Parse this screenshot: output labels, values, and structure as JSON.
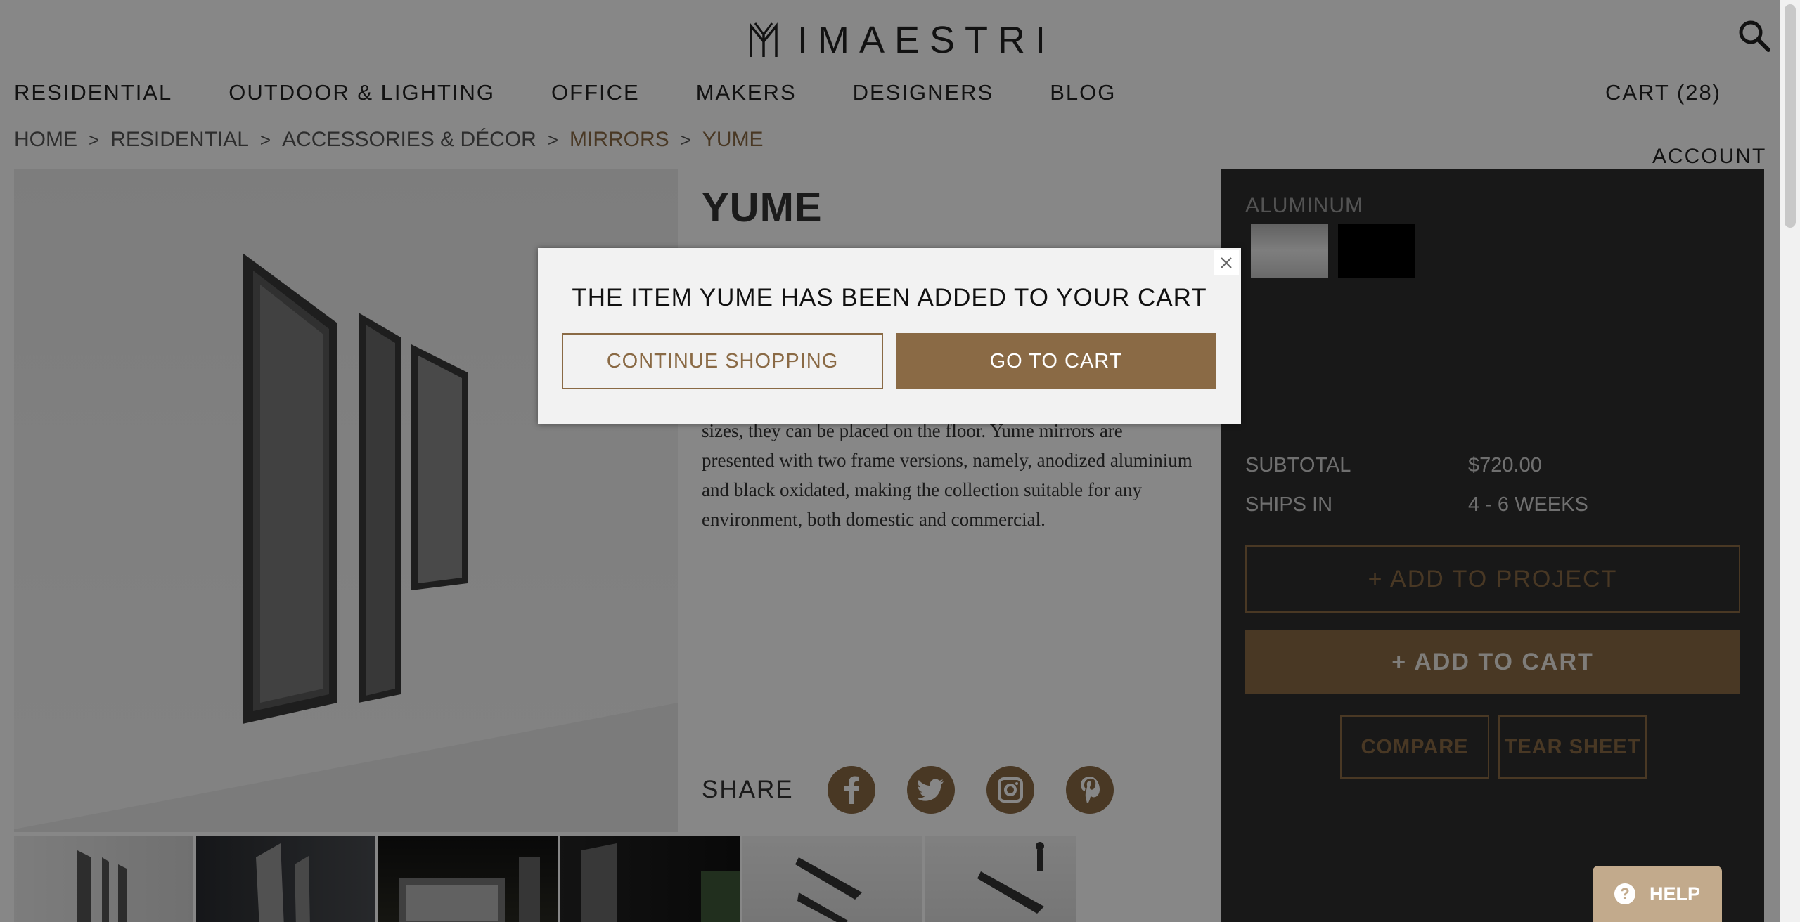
{
  "brand": {
    "name": "IMAESTRI"
  },
  "nav": {
    "items": [
      "RESIDENTIAL",
      "OUTDOOR & LIGHTING",
      "OFFICE",
      "MAKERS",
      "DESIGNERS",
      "BLOG"
    ],
    "cart_label": "CART (28)",
    "account_label": "ACCOUNT"
  },
  "breadcrumb": {
    "items": [
      "HOME",
      "RESIDENTIAL",
      "ACCESSORIES & DÉCOR",
      "MIRRORS",
      "YUME"
    ],
    "separator": ">"
  },
  "product": {
    "title": "YUME",
    "description_lines": [
      "sizes, they can be placed on the floor. Yume mirrors are",
      "presented with two frame versions, namely, anodized aluminium",
      "and black oxidated, making the collection suitable for any",
      "environment, both domestic and commercial."
    ],
    "share_label": "SHARE",
    "social_icons": [
      "facebook-icon",
      "twitter-icon",
      "instagram-icon",
      "pinterest-icon"
    ]
  },
  "options": {
    "finish_label": "ALUMINUM",
    "swatches": [
      {
        "name": "Aluminum",
        "color": "#d9d9d9"
      },
      {
        "name": "Black",
        "color": "#000000"
      }
    ]
  },
  "pricing": {
    "subtotal_label": "SUBTOTAL",
    "subtotal_value": "$720.00",
    "ships_label": "SHIPS IN",
    "ships_value": "4 - 6 WEEKS"
  },
  "actions": {
    "add_to_project": "+ ADD TO PROJECT",
    "add_to_cart": "+ ADD TO CART",
    "compare": "COMPARE",
    "tear_sheet": "TEAR SHEET",
    "help": "HELP"
  },
  "modal": {
    "message": "THE ITEM YUME HAS BEEN ADDED TO YOUR CART",
    "continue_label": "CONTINUE SHOPPING",
    "go_to_cart_label": "GO TO CART",
    "close_symbol": "✕"
  },
  "colors": {
    "accent": "#8a6a45",
    "panel": "#2e2e2e",
    "help": "#c2aa8c"
  }
}
